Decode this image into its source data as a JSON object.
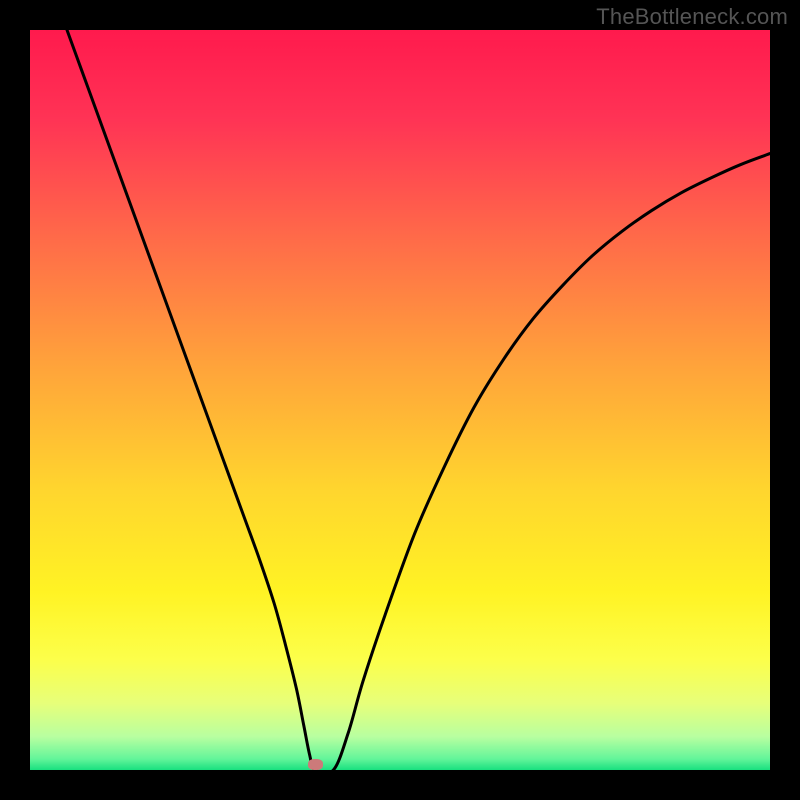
{
  "watermark": "TheBottleneck.com",
  "chart_data": {
    "type": "line",
    "title": "",
    "xlabel": "",
    "ylabel": "",
    "xlim": [
      0,
      100
    ],
    "ylim": [
      0,
      100
    ],
    "grid": false,
    "legend": false,
    "annotations": [],
    "series": [
      {
        "name": "curve",
        "color": "#000000",
        "x": [
          5,
          7,
          9,
          11,
          13,
          15,
          17,
          19,
          21,
          23,
          25,
          27,
          29,
          31,
          33,
          34.5,
          36,
          37,
          37.8,
          38.5,
          41,
          43,
          45,
          48,
          52,
          56,
          60,
          64,
          68,
          72,
          76,
          80,
          84,
          88,
          92,
          96,
          100
        ],
        "y": [
          100,
          94.5,
          89,
          83.5,
          78,
          72.5,
          67,
          61.5,
          56,
          50.5,
          45,
          39.5,
          34,
          28.5,
          22.5,
          17,
          11,
          6,
          2,
          0,
          0,
          5,
          12,
          21,
          32,
          41,
          49,
          55.5,
          61,
          65.5,
          69.5,
          72.8,
          75.6,
          78,
          80,
          81.8,
          83.3
        ]
      }
    ],
    "marker": {
      "x": 38.6,
      "y": 0,
      "color": "#cc7a7a"
    },
    "background_gradient": {
      "direction": "vertical",
      "stops": [
        {
          "pos": 0.0,
          "color": "#ff1a4d"
        },
        {
          "pos": 0.12,
          "color": "#ff3355"
        },
        {
          "pos": 0.28,
          "color": "#ff6a49"
        },
        {
          "pos": 0.45,
          "color": "#ffa23b"
        },
        {
          "pos": 0.62,
          "color": "#ffd52e"
        },
        {
          "pos": 0.76,
          "color": "#fff324"
        },
        {
          "pos": 0.85,
          "color": "#fcff4a"
        },
        {
          "pos": 0.91,
          "color": "#e7ff7a"
        },
        {
          "pos": 0.955,
          "color": "#b8ffa0"
        },
        {
          "pos": 0.985,
          "color": "#63f59a"
        },
        {
          "pos": 1.0,
          "color": "#18e07f"
        }
      ]
    }
  }
}
